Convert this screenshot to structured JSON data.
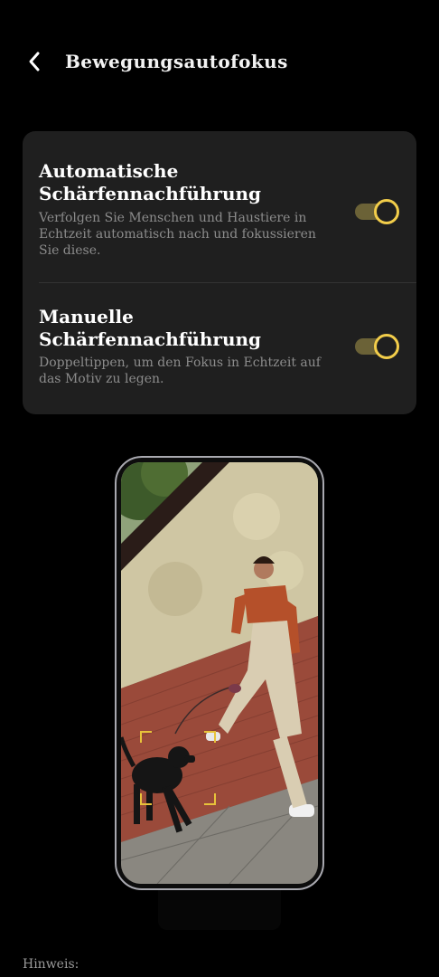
{
  "header": {
    "back_icon": "chevron-left-icon",
    "title": "Bewegungsautofokus"
  },
  "settings": [
    {
      "title": "Automatische Schärfennachführung",
      "description": "Verfolgen Sie Menschen und Haustiere in Echtzeit automatisch nach und fokussieren Sie diese.",
      "enabled": true
    },
    {
      "title": "Manuelle Schärfennachführung",
      "description": "Doppeltippen, um den Fokus in Echtzeit auf das Motiv zu legen.",
      "enabled": true
    }
  ],
  "colors": {
    "background": "#000000",
    "card": "#1f1f1f",
    "accent": "#f2cd4a",
    "toggle_track": "#6b6237",
    "focus_frame": "#e8c33a"
  },
  "footer": {
    "note_label": "Hinweis:"
  }
}
